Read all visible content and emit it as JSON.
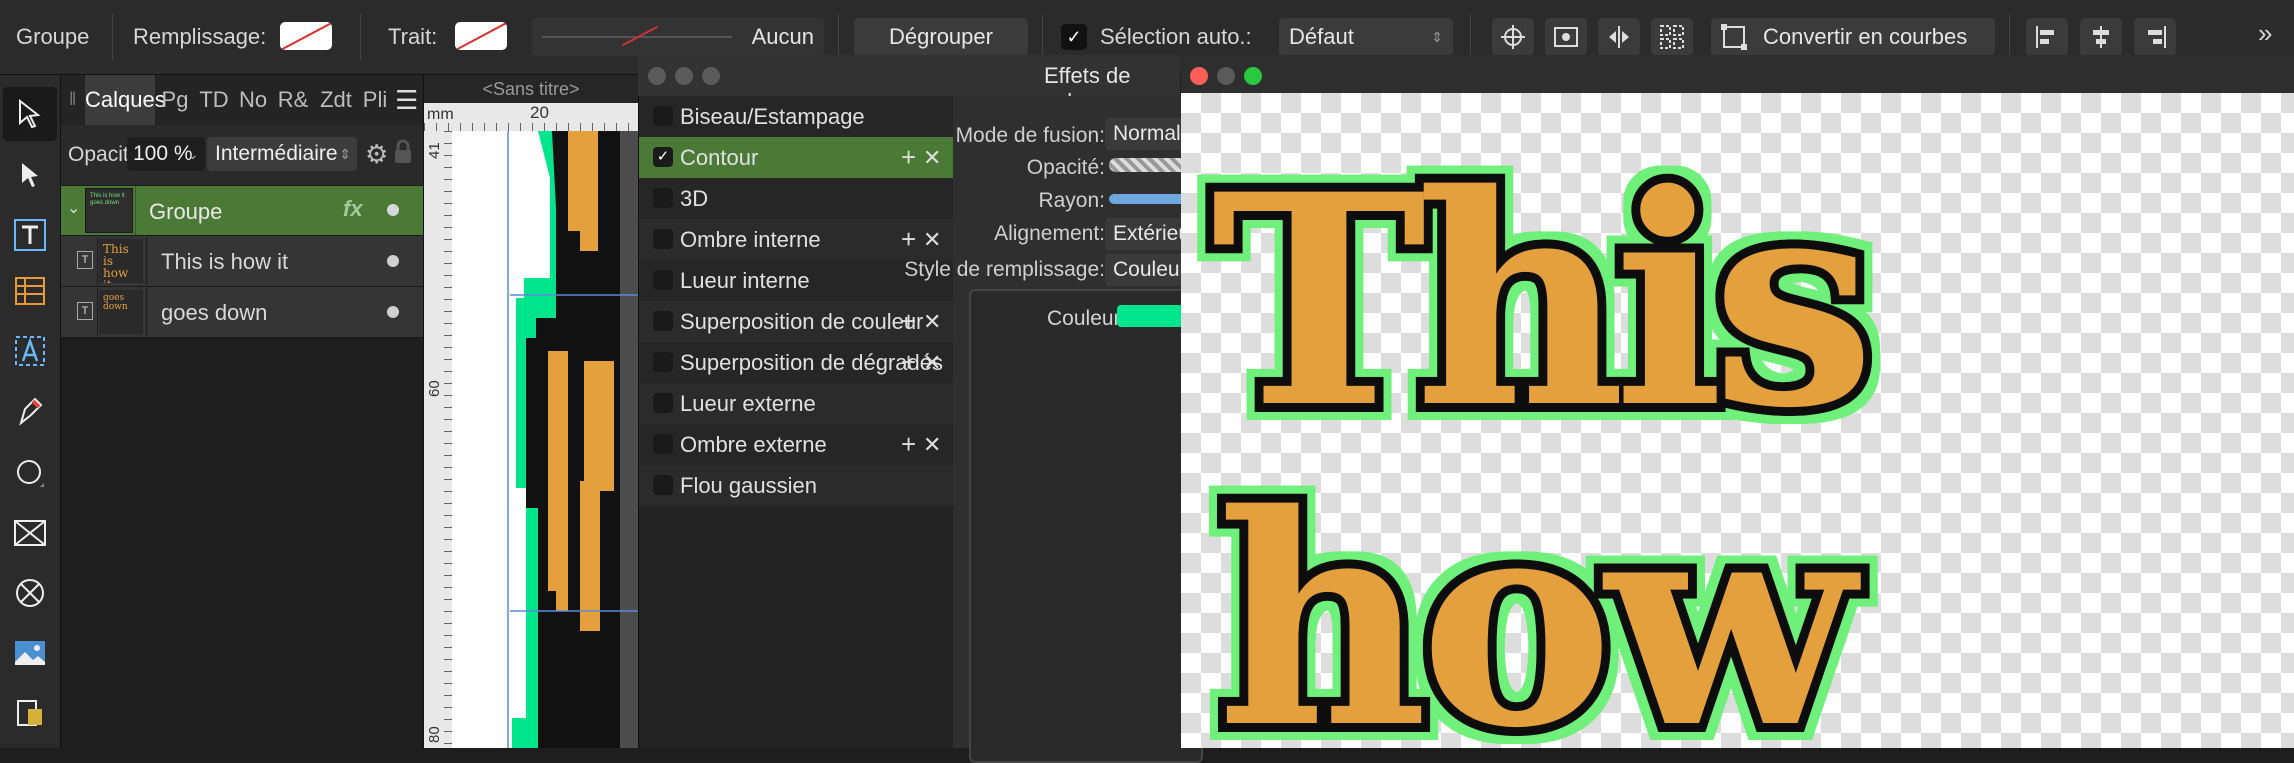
{
  "toolbar": {
    "group_label": "Groupe",
    "fill_label": "Remplissage:",
    "stroke_label": "Trait:",
    "stroke_value": "Aucun",
    "ungroup_button": "Dégrouper",
    "auto_select_label": "Sélection auto.:",
    "auto_select_value": "Défaut",
    "convert_button": "Convertir en courbes"
  },
  "layers_panel": {
    "tabs": [
      "Calques",
      "Pg",
      "TD",
      "No",
      "R&",
      "Zdt",
      "Pli"
    ],
    "opacity_label": "Opacité:",
    "opacity_value": "100 %",
    "blend_mode": "Intermédiaire",
    "layers": [
      {
        "name": "Groupe",
        "thumb": "This is how it goes down"
      },
      {
        "name": "This is how it",
        "thumb": "This is how it"
      },
      {
        "name": "goes down",
        "thumb": "goes down"
      }
    ]
  },
  "canvas": {
    "document_title": "<Sans titre>",
    "unit": "mm",
    "ruler_top": [
      "20"
    ],
    "ruler_left": [
      "41",
      "60",
      "80"
    ]
  },
  "effects_dialog": {
    "title": "Effets de calque",
    "effects": [
      {
        "label": "Biseau/Estampage",
        "checked": false,
        "add_remove": false
      },
      {
        "label": "Contour",
        "checked": true,
        "add_remove": true
      },
      {
        "label": "3D",
        "checked": false,
        "add_remove": false
      },
      {
        "label": "Ombre interne",
        "checked": false,
        "add_remove": true
      },
      {
        "label": "Lueur interne",
        "checked": false,
        "add_remove": false
      },
      {
        "label": "Superposition de couleur",
        "checked": false,
        "add_remove": true
      },
      {
        "label": "Superposition de dégradés",
        "checked": false,
        "add_remove": true
      },
      {
        "label": "Lueur externe",
        "checked": false,
        "add_remove": false
      },
      {
        "label": "Ombre externe",
        "checked": false,
        "add_remove": true
      },
      {
        "label": "Flou gaussien",
        "checked": false,
        "add_remove": false
      }
    ],
    "properties": {
      "blend_label": "Mode de fusion:",
      "blend_value": "Normal",
      "opacity_label": "Opacité:",
      "radius_label": "Rayon:",
      "align_label": "Alignement:",
      "align_value": "Extérieur",
      "fill_style_label": "Style de remplissage:",
      "fill_style_value": "Couleur ur",
      "color_label": "Couleur:"
    }
  },
  "preview": {
    "line1": "This",
    "line2": "how"
  },
  "colors": {
    "accent_green": "#4a7a35",
    "stroke_color": "#00e58b",
    "preview_glow": "#6ef07a",
    "letter_fill": "#e4a03c"
  }
}
